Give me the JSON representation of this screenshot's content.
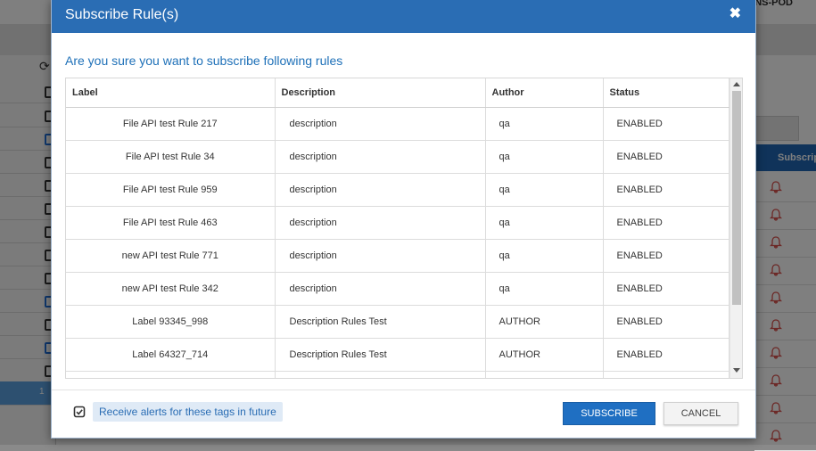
{
  "background": {
    "top_label": "NS-POD",
    "right_column_header": "Subscrip",
    "selected_row_number": "1"
  },
  "modal": {
    "title": "Subscribe Rule(s)",
    "close_glyph": "✖",
    "confirm_text": "Are you sure you want to subscribe following rules",
    "columns": {
      "label": "Label",
      "description": "Description",
      "author": "Author",
      "status": "Status"
    },
    "rows": [
      {
        "label": "File API test Rule 217",
        "description": "description",
        "author": "qa",
        "status": "ENABLED"
      },
      {
        "label": "File API test Rule 34",
        "description": "description",
        "author": "qa",
        "status": "ENABLED"
      },
      {
        "label": "File API test Rule 959",
        "description": "description",
        "author": "qa",
        "status": "ENABLED"
      },
      {
        "label": "File API test Rule 463",
        "description": "description",
        "author": "qa",
        "status": "ENABLED"
      },
      {
        "label": "new API test Rule 771",
        "description": "description",
        "author": "qa",
        "status": "ENABLED"
      },
      {
        "label": "new API test Rule 342",
        "description": "description",
        "author": "qa",
        "status": "ENABLED"
      },
      {
        "label": "Label 93345_998",
        "description": "Description Rules Test",
        "author": "AUTHOR",
        "status": "ENABLED"
      },
      {
        "label": "Label 64327_714",
        "description": "Description Rules Test",
        "author": "AUTHOR",
        "status": "ENABLED"
      }
    ],
    "future_alerts_label": "Receive alerts for these tags in future",
    "future_alerts_checked": true,
    "subscribe_label": "SUBSCRIBE",
    "cancel_label": "CANCEL"
  },
  "colors": {
    "header_blue": "#2a6db4",
    "link_blue": "#1e70b8",
    "bell_red": "#d9534f"
  }
}
